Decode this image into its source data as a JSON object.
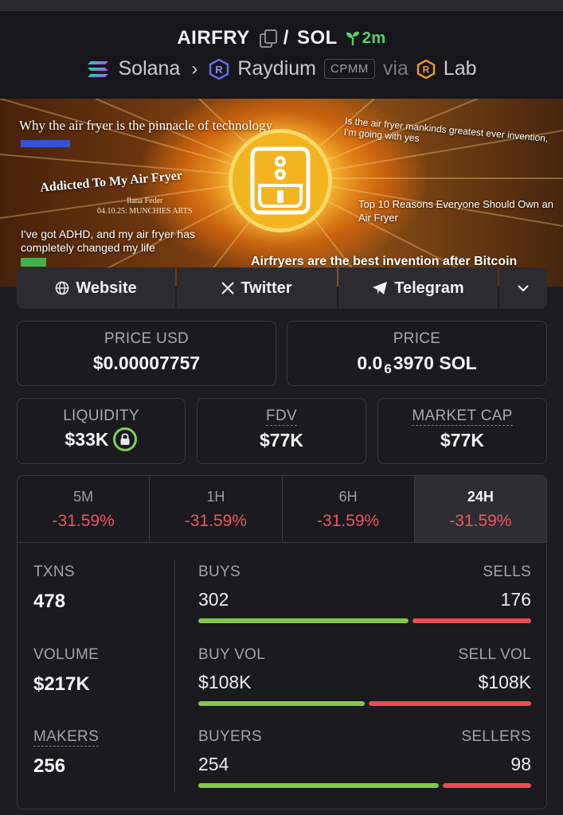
{
  "header": {
    "token": "AIRFRY",
    "separator": "/",
    "quote": "SOL",
    "age": "2m",
    "chain": "Solana",
    "dex": "Raydium",
    "pool_type": "CPMM",
    "via": "via",
    "launchpad": "Lab"
  },
  "banner": {
    "headline_1": "Why the air fryer is the pinnacle of technology",
    "headline_2": "Addicted To My Air Fryer",
    "author": "Ilana Feder",
    "author_meta": "04.10.25: MUNCHIES ARTS",
    "headline_3": "I've got ADHD, and my air fryer has completely changed my life",
    "headline_4": "Is the air fryer mankinds greatest ever invention, I'm going with yes",
    "headline_5": "Top 10 Reasons Everyone Should Own an Air Fryer",
    "headline_6": "Airfryers are the best invention after Bitcoin"
  },
  "links": {
    "website": "Website",
    "twitter": "Twitter",
    "telegram": "Telegram"
  },
  "price_usd": {
    "label": "PRICE USD",
    "value": "$0.00007757"
  },
  "price_native": {
    "label": "PRICE",
    "prefix": "0.0",
    "zeros": "6",
    "suffix": "3970 SOL"
  },
  "liquidity": {
    "label": "LIQUIDITY",
    "value": "$33K"
  },
  "fdv": {
    "label": "FDV",
    "value": "$77K"
  },
  "market_cap": {
    "label": "MARKET CAP",
    "value": "$77K"
  },
  "timeframes": [
    {
      "label": "5M",
      "change": "-31.59%"
    },
    {
      "label": "1H",
      "change": "-31.59%"
    },
    {
      "label": "6H",
      "change": "-31.59%"
    },
    {
      "label": "24H",
      "change": "-31.59%"
    }
  ],
  "stats": {
    "txns": {
      "label": "TXNS",
      "value": "478"
    },
    "volume": {
      "label": "VOLUME",
      "value": "$217K"
    },
    "makers": {
      "label": "MAKERS",
      "value": "256"
    },
    "buys": {
      "label": "BUYS",
      "value": "302"
    },
    "sells": {
      "label": "SELLS",
      "value": "176"
    },
    "buy_vol": {
      "label": "BUY VOL",
      "value": "$108K"
    },
    "sell_vol": {
      "label": "SELL VOL",
      "value": "$108K"
    },
    "buyers": {
      "label": "BUYERS",
      "value": "254"
    },
    "sellers": {
      "label": "SELLERS",
      "value": "98"
    },
    "buy_share": 0.632,
    "buy_vol_share": 0.5,
    "buyer_share": 0.722
  },
  "colors": {
    "positive": "#84c84a",
    "negative": "#ea4d52",
    "age": "#5ad16a"
  }
}
